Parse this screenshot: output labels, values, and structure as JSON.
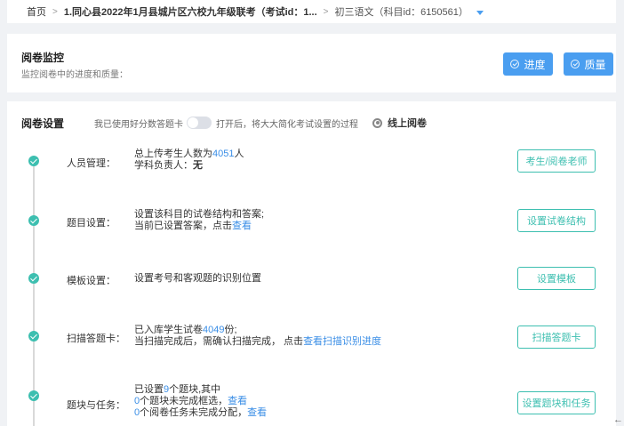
{
  "breadcrumb": {
    "home": "首页",
    "sep1": ">",
    "exam": "1.同心县2022年1月县城片区六校九年级联考（考试id：1...",
    "sep2": ">",
    "subject": "初三语文（科目id：6150561）"
  },
  "monitor": {
    "title": "阅卷监控",
    "desc": "监控阅卷中的进度和质量：",
    "progress_label": "进度",
    "quality_label": "质量"
  },
  "settings": {
    "title": "阅卷设置",
    "toggle_hint_before": "我已使用好分数答题卡",
    "toggle_hint_after": "打开后，将大大简化考试设置的过程",
    "online_label": "线上阅卷"
  },
  "steps": [
    {
      "label": "人员管理：",
      "line1_a": "总上传考生人数为",
      "line1_num": "4051",
      "line1_b": "人",
      "line2_a": "学科负责人：",
      "line2_b": "无",
      "button": "考生/阅卷老师"
    },
    {
      "label": "题目设置：",
      "line1": "设置该科目的试卷结构和答案;",
      "line2_a": "当前已设置答案，点击",
      "line2_link": "查看",
      "button": "设置试卷结构"
    },
    {
      "label": "模板设置：",
      "line1": "设置考号和客观题的识别位置",
      "button": "设置模板"
    },
    {
      "label": "扫描答题卡：",
      "line1_a": "已入库学生试卷",
      "line1_num": "4049",
      "line1_b": "份;",
      "line2_a": "当扫描完成后，需确认扫描完成， 点击",
      "line2_link": "查看扫描识别进度",
      "button": "扫描答题卡"
    },
    {
      "label": "题块与任务：",
      "line1_a": "已设置",
      "line1_num": "9",
      "line1_b": "个题块,其中",
      "line2_num": "0",
      "line2_a": "个题块未完成框选，",
      "line2_link": "查看",
      "line3_num": "0",
      "line3_a": "个阅卷任务未完成分配，",
      "line3_link": "查看",
      "button": "设置题块和任务"
    }
  ],
  "footer": {
    "back_icon": "←"
  },
  "colors": {
    "accent_blue": "#4a9ef0",
    "teal": "#3dbfb0",
    "link": "#3a8ee6"
  }
}
